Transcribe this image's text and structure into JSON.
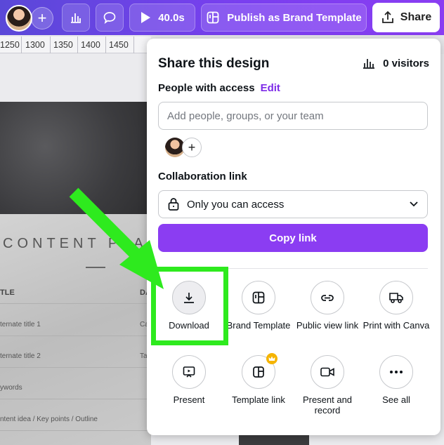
{
  "toolbar": {
    "plus": "+",
    "timer": "40.0s",
    "publish_label": "Publish as Brand Template",
    "share_label": "Share"
  },
  "ruler": {
    "ticks": [
      "1250",
      "1300",
      "1350",
      "1400",
      "1450"
    ]
  },
  "canvas": {
    "title": "CONTENT PLA",
    "col1": "TLE",
    "col2": "DA",
    "rows": [
      "ternate title 1",
      "ternate title 2",
      "ywords",
      "ntent idea / Key points / Outline"
    ],
    "row_right": [
      "Ca",
      "Ta"
    ]
  },
  "share_panel": {
    "title": "Share this design",
    "visitors": "0 visitors",
    "people_label": "People with access",
    "edit_label": "Edit",
    "add_placeholder": "Add people, groups, or your team",
    "add_plus": "+",
    "collab_label": "Collaboration link",
    "access_value": "Only you can access",
    "copy_label": "Copy link",
    "options": [
      {
        "label": "Download"
      },
      {
        "label": "Brand Template"
      },
      {
        "label": "Public view link"
      },
      {
        "label": "Print with Canva"
      },
      {
        "label": "Present"
      },
      {
        "label": "Template link"
      },
      {
        "label": "Present and record"
      },
      {
        "label": "See all"
      }
    ]
  },
  "colors": {
    "accent": "#8b3df2",
    "highlight": "#2eea1e"
  }
}
